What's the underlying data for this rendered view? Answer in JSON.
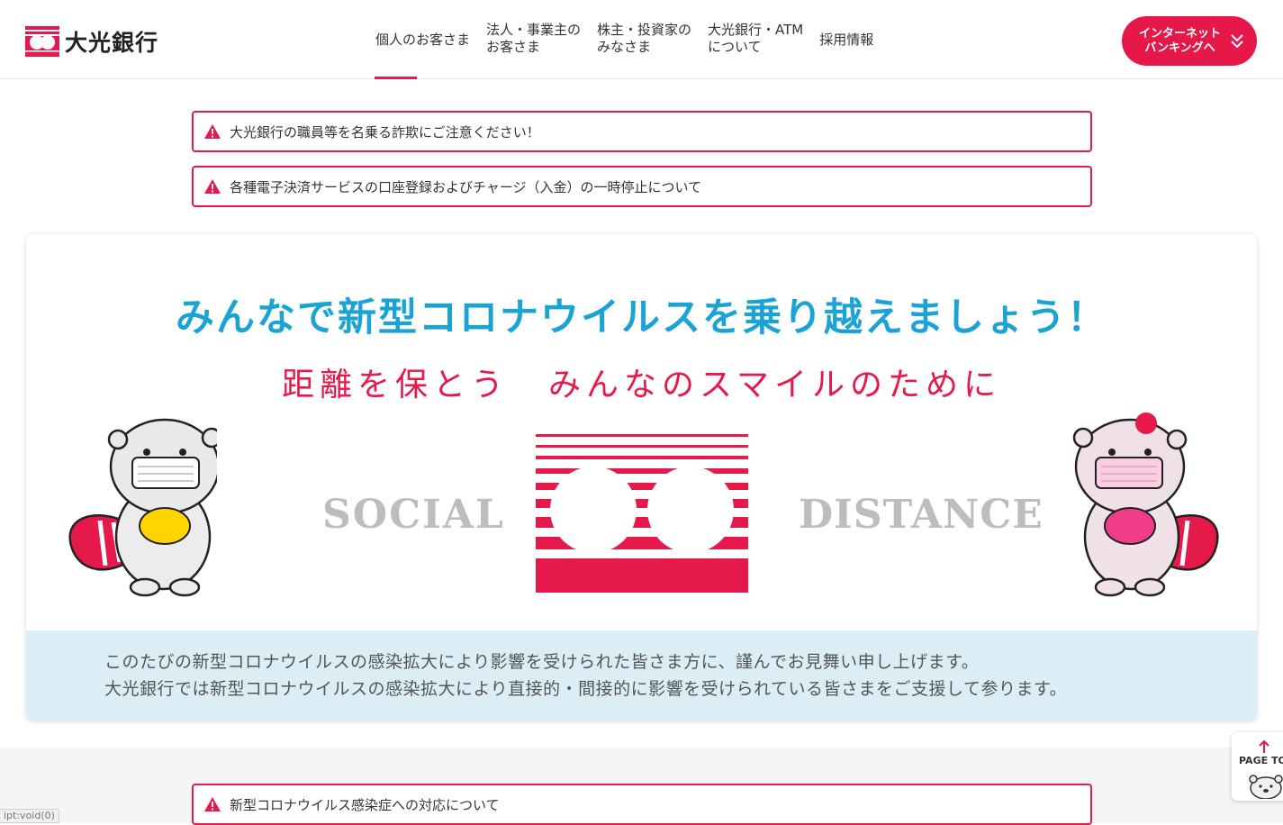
{
  "header": {
    "logo_text": "大光銀行",
    "nav": [
      {
        "label": "個人のお客さま",
        "active": true
      },
      {
        "label": "法人・事業主の\nお客さま"
      },
      {
        "label": "株主・投資家の\nみなさま"
      },
      {
        "label": "大光銀行・ATM\nについて"
      },
      {
        "label": "採用情報"
      }
    ],
    "internet_banking_label": "インターネット\nバンキングへ"
  },
  "alerts": [
    {
      "text": "大光銀行の職員等を名乗る詐欺にご注意ください！"
    },
    {
      "text": "各種電子決済サービスの口座登録およびチャージ（入金）の一時停止について"
    },
    {
      "text": "新型コロナウイルス感染症への対応について"
    }
  ],
  "banner": {
    "title": "みんなで新型コロナウイルスを乗り越えましょう！",
    "subtitle_left": "距離を保とう",
    "subtitle_right": "みんなのスマイルのために",
    "social": "SOCIAL",
    "distance": "DISTANCE",
    "message_line1": "このたびの新型コロナウイルスの感染拡大により影響を受けられた皆さま方に、謹んでお見舞い申し上げます。",
    "message_line2": "大光銀行では新型コロナウイルスの感染拡大により直接的・間接的に影響を受けられている皆さまをご支援して参ります。"
  },
  "page_top_label": "PAGE TO",
  "status_url": "ipt:void(0)",
  "colors": {
    "brand": "#e6194b",
    "title_blue": "#1ba3d5",
    "message_bg": "#dbeef5"
  }
}
